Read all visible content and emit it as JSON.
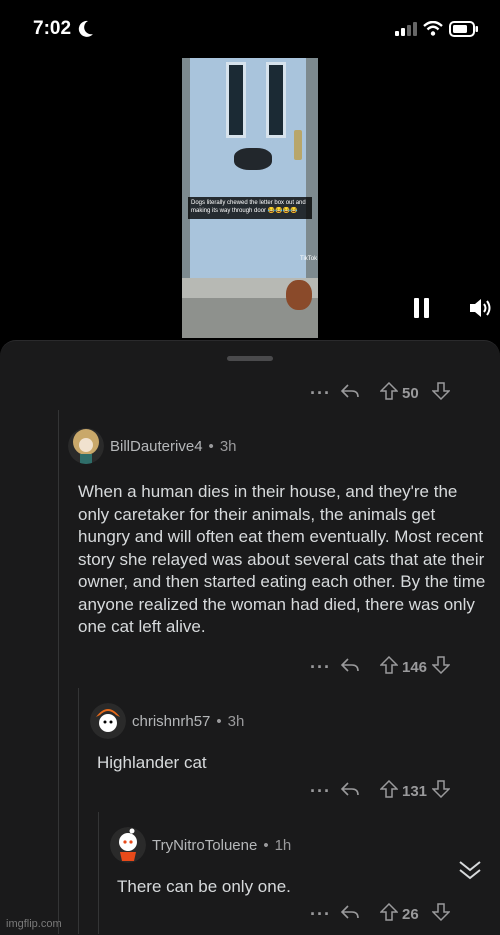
{
  "status_bar": {
    "time": "7:02"
  },
  "video": {
    "caption": "Dogs literally chewed the letter box out and making its way through door 😂😂😂😂",
    "watermark": "TikTok"
  },
  "comments": [
    {
      "votes": "50"
    },
    {
      "author": "BillDauterive4",
      "age": "3h",
      "body": "When a human dies in their house, and they're the only caretaker for their animals, the animals get hungry and will often eat them eventually. Most recent story she relayed was about several cats that ate their owner, and then started eating each other. By the time anyone realized the woman had died, there was only one cat left alive.",
      "votes": "146"
    },
    {
      "author": "chrishnrh57",
      "age": "3h",
      "body": "Highlander cat",
      "votes": "131"
    },
    {
      "author": "TryNitroToluene",
      "age": "1h",
      "body": "There can be only one.",
      "votes": "26"
    }
  ],
  "separator": "•",
  "more_label": "···",
  "footer_watermark": "imgflip.com",
  "colors": {
    "background": "#000000",
    "sheet": "#1a1a1b",
    "text": "#d7dadc",
    "muted": "#9a9a9c"
  }
}
